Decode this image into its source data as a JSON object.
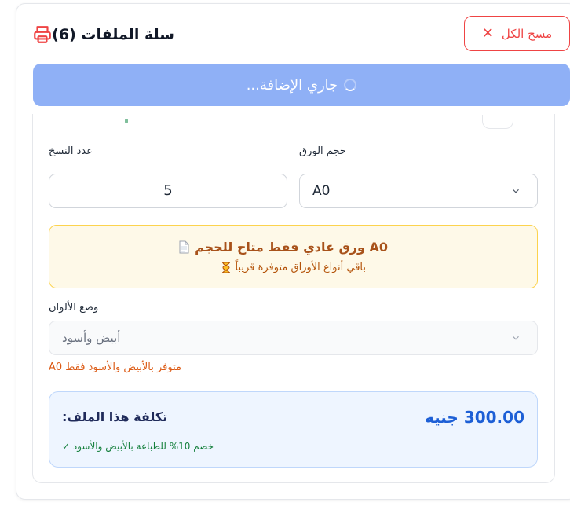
{
  "header": {
    "title": "سلة الملفات (6)",
    "clear_all_label": "مسح الكل"
  },
  "status": {
    "adding_label": "...جاري الإضافة"
  },
  "file_options": {
    "copies_label": "عدد النسخ",
    "copies_value": "5",
    "paper_size_label": "حجم الورق",
    "paper_size_value": "A0",
    "notice_main": "A0 ورق عادي فقط متاح للحجم",
    "notice_sub": "باقي أنواع الأوراق متوفرة قريباً",
    "color_mode_label": "وضع الألوان",
    "color_mode_value": "أبيض وأسود",
    "color_mode_note": "متوفر بالأبيض والأسود فقط A0"
  },
  "cost": {
    "label": "تكلفة هذا الملف:",
    "value": "300.00 جنيه",
    "discount_note": "خصم 10% للطباعة بالأبيض والأسود ✓"
  },
  "icons": {
    "printer": "printer-icon",
    "close": "close-icon",
    "spinner": "spinner-icon",
    "document": "document-icon",
    "hourglass": "hourglass-icon",
    "chevron": "chevron-down-icon"
  },
  "colors": {
    "danger": "#ef4444",
    "primary_disabled": "#8fb0f6",
    "warning_bg": "#fef9e8",
    "price": "#1d5fd6",
    "success": "#15803d"
  }
}
